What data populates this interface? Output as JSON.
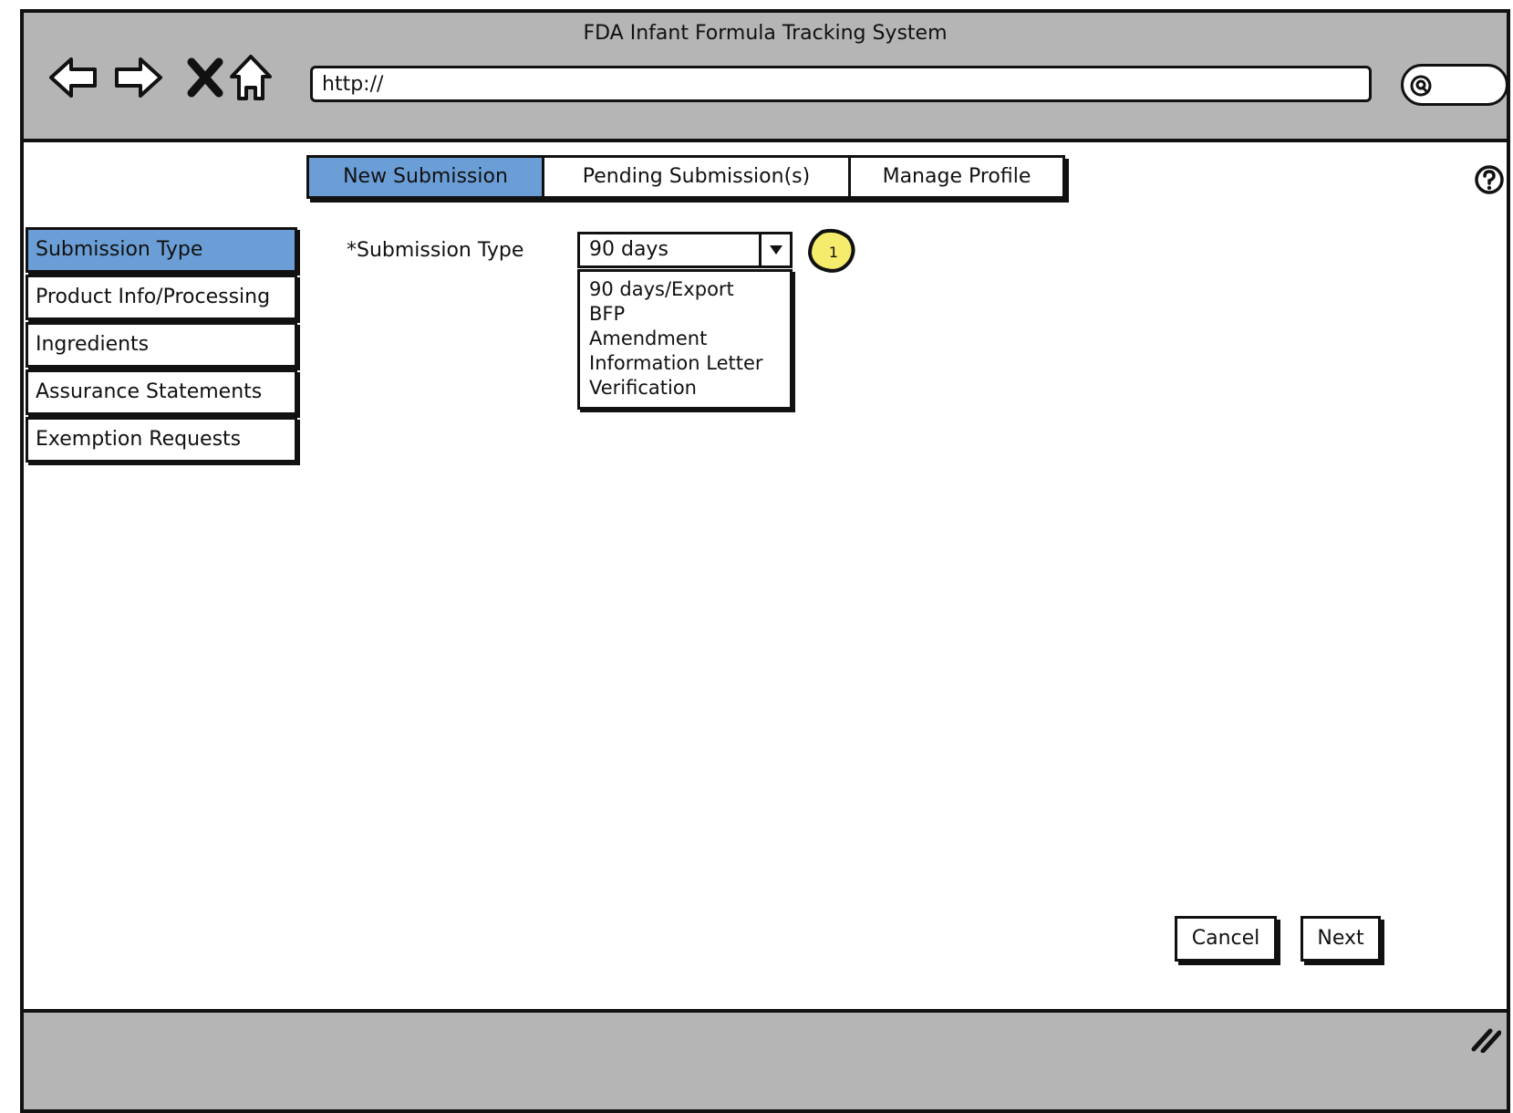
{
  "window": {
    "title": "FDA Infant Formula Tracking System"
  },
  "browser": {
    "url": "http://",
    "nav_icons": [
      "back-arrow-icon",
      "forward-arrow-icon",
      "close-x-icon",
      "home-icon"
    ],
    "search_icon": "magnifier-icon"
  },
  "tabs": [
    {
      "label": "New Submission",
      "active": true
    },
    {
      "label": "Pending Submission(s)",
      "active": false
    },
    {
      "label": "Manage Profile",
      "active": false
    }
  ],
  "help_icon": "question-mark-icon",
  "sidebar": {
    "items": [
      {
        "label": "Submission Type",
        "active": true
      },
      {
        "label": "Product Info/Processing",
        "active": false
      },
      {
        "label": "Ingredients",
        "active": false
      },
      {
        "label": "Assurance Statements",
        "active": false
      },
      {
        "label": "Exemption Requests",
        "active": false
      }
    ]
  },
  "form": {
    "submission_type_label": "*Submission Type",
    "submission_type_value": "90 days",
    "options": [
      "90 days/Export",
      "BFP",
      "Amendment",
      "Information Letter",
      "Verification"
    ]
  },
  "annotation_badge": {
    "number": "1",
    "color": "#f5ec6e"
  },
  "buttons": {
    "cancel": "Cancel",
    "next": "Next"
  },
  "colors": {
    "accent": "#6b9ed6",
    "chrome": "#b5b5b5"
  }
}
